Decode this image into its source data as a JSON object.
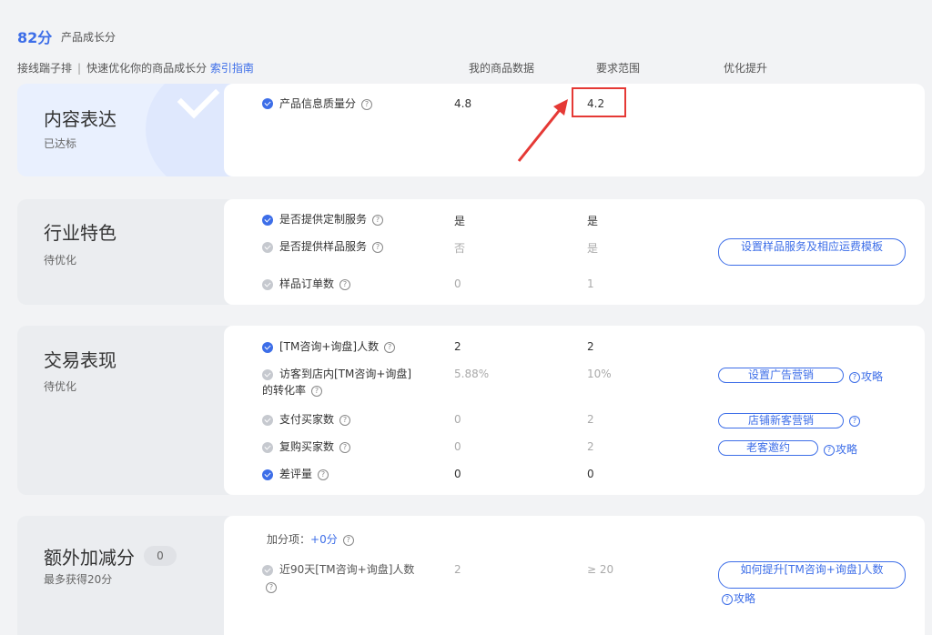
{
  "header": {
    "score": "82分",
    "score_label": "产品成长分",
    "subtitle_prefix": "接线踹子排",
    "subtitle_main": "快速优化你的商品成长分",
    "guide_link": "索引指南"
  },
  "columns": {
    "mine": "我的商品数据",
    "required": "要求范围",
    "optimize": "优化提升"
  },
  "sections": {
    "content": {
      "title": "内容表达",
      "status": "已达标",
      "rows": [
        {
          "label": "产品信息质量分",
          "mine": "4.8",
          "required": "4.2"
        }
      ]
    },
    "industry": {
      "title": "行业特色",
      "status": "待优化",
      "rows": [
        {
          "label": "是否提供定制服务",
          "mine": "是",
          "required": "是"
        },
        {
          "label": "是否提供样品服务",
          "mine": "否",
          "required": "是",
          "action": "设置样品服务及相应运费模板"
        },
        {
          "label": "样品订单数",
          "mine": "0",
          "required": "1"
        }
      ]
    },
    "trade": {
      "title": "交易表现",
      "status": "待优化",
      "rows": [
        {
          "label": "[TM咨询+询盘]人数",
          "mine": "2",
          "required": "2"
        },
        {
          "label": "访客到店内[TM咨询+询盘]",
          "label2": "的转化率",
          "mine": "5.88%",
          "required": "10%",
          "action": "设置广告营销",
          "aside": "攻略"
        },
        {
          "label": "支付买家数",
          "mine": "0",
          "required": "2",
          "action": "店铺新客营销"
        },
        {
          "label": "复购买家数",
          "mine": "0",
          "required": "2",
          "action": "老客邀约",
          "aside": "攻略"
        },
        {
          "label": "差评量",
          "mine": "0",
          "required": "0"
        }
      ]
    },
    "extra": {
      "title": "额外加减分",
      "badge": "0",
      "status": "最多获得20分",
      "bonus_label": "加分项：",
      "bonus_value": "+0分",
      "rows": [
        {
          "label": "近90天[TM咨询+询盘]人数",
          "mine": "2",
          "required": "≥ 20",
          "action": "如何提升[TM咨询+询盘]人数",
          "aside": "攻略"
        }
      ]
    }
  },
  "colors": {
    "accent": "#3d6ee8",
    "highlight": "#e53935"
  }
}
